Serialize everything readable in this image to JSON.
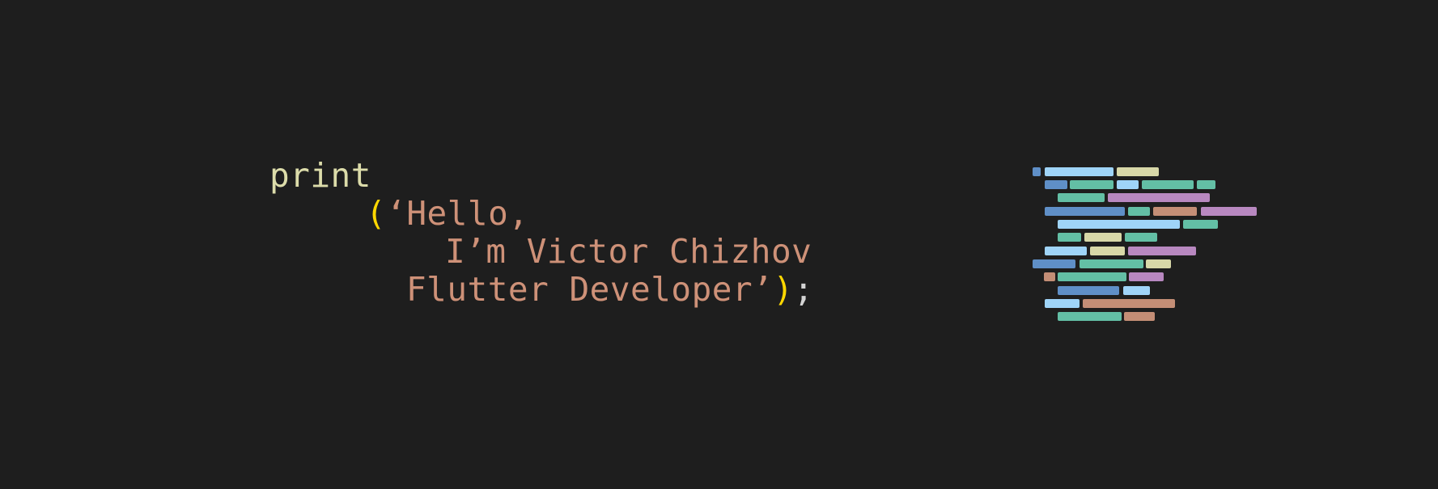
{
  "code": {
    "line1": {
      "fn": "print"
    },
    "line2": {
      "open_paren": "(",
      "text": "‘Hello,"
    },
    "line3": {
      "text": "I’m Victor Chizhov"
    },
    "line4": {
      "text": "Flutter Developer’",
      "close_paren": ")",
      "semicolon": ";"
    }
  },
  "colors": {
    "background": "#1e1e1e",
    "function": "#dcdcaa",
    "paren": "#ffd700",
    "string": "#ce9178",
    "punctuation": "#d4d4d4",
    "minimap_blue": "#5f8fc7",
    "minimap_lightblue": "#9fd4f8",
    "minimap_teal": "#63bfa5",
    "minimap_yellow": "#d8d8a8",
    "minimap_purple": "#b888c0",
    "minimap_orange": "#c48e76"
  },
  "minimap": {
    "rows": [
      [
        "minimap_blue",
        "minimap_lightblue",
        "minimap_yellow"
      ],
      [
        "minimap_blue",
        "minimap_teal",
        "minimap_lightblue",
        "minimap_teal",
        "minimap_teal"
      ],
      [
        "minimap_teal",
        "minimap_purple"
      ],
      [
        "minimap_blue",
        "minimap_teal",
        "minimap_orange",
        "minimap_purple"
      ],
      [
        "minimap_lightblue",
        "minimap_teal"
      ],
      [
        "minimap_teal",
        "minimap_yellow",
        "minimap_teal"
      ],
      [
        "minimap_lightblue",
        "minimap_yellow",
        "minimap_purple"
      ],
      [
        "minimap_blue",
        "minimap_teal",
        "minimap_yellow"
      ],
      [
        "minimap_orange",
        "minimap_teal",
        "minimap_purple"
      ],
      [
        "minimap_blue",
        "minimap_lightblue"
      ],
      [
        "minimap_lightblue",
        "minimap_orange"
      ],
      [
        "minimap_teal",
        "minimap_orange"
      ]
    ]
  }
}
